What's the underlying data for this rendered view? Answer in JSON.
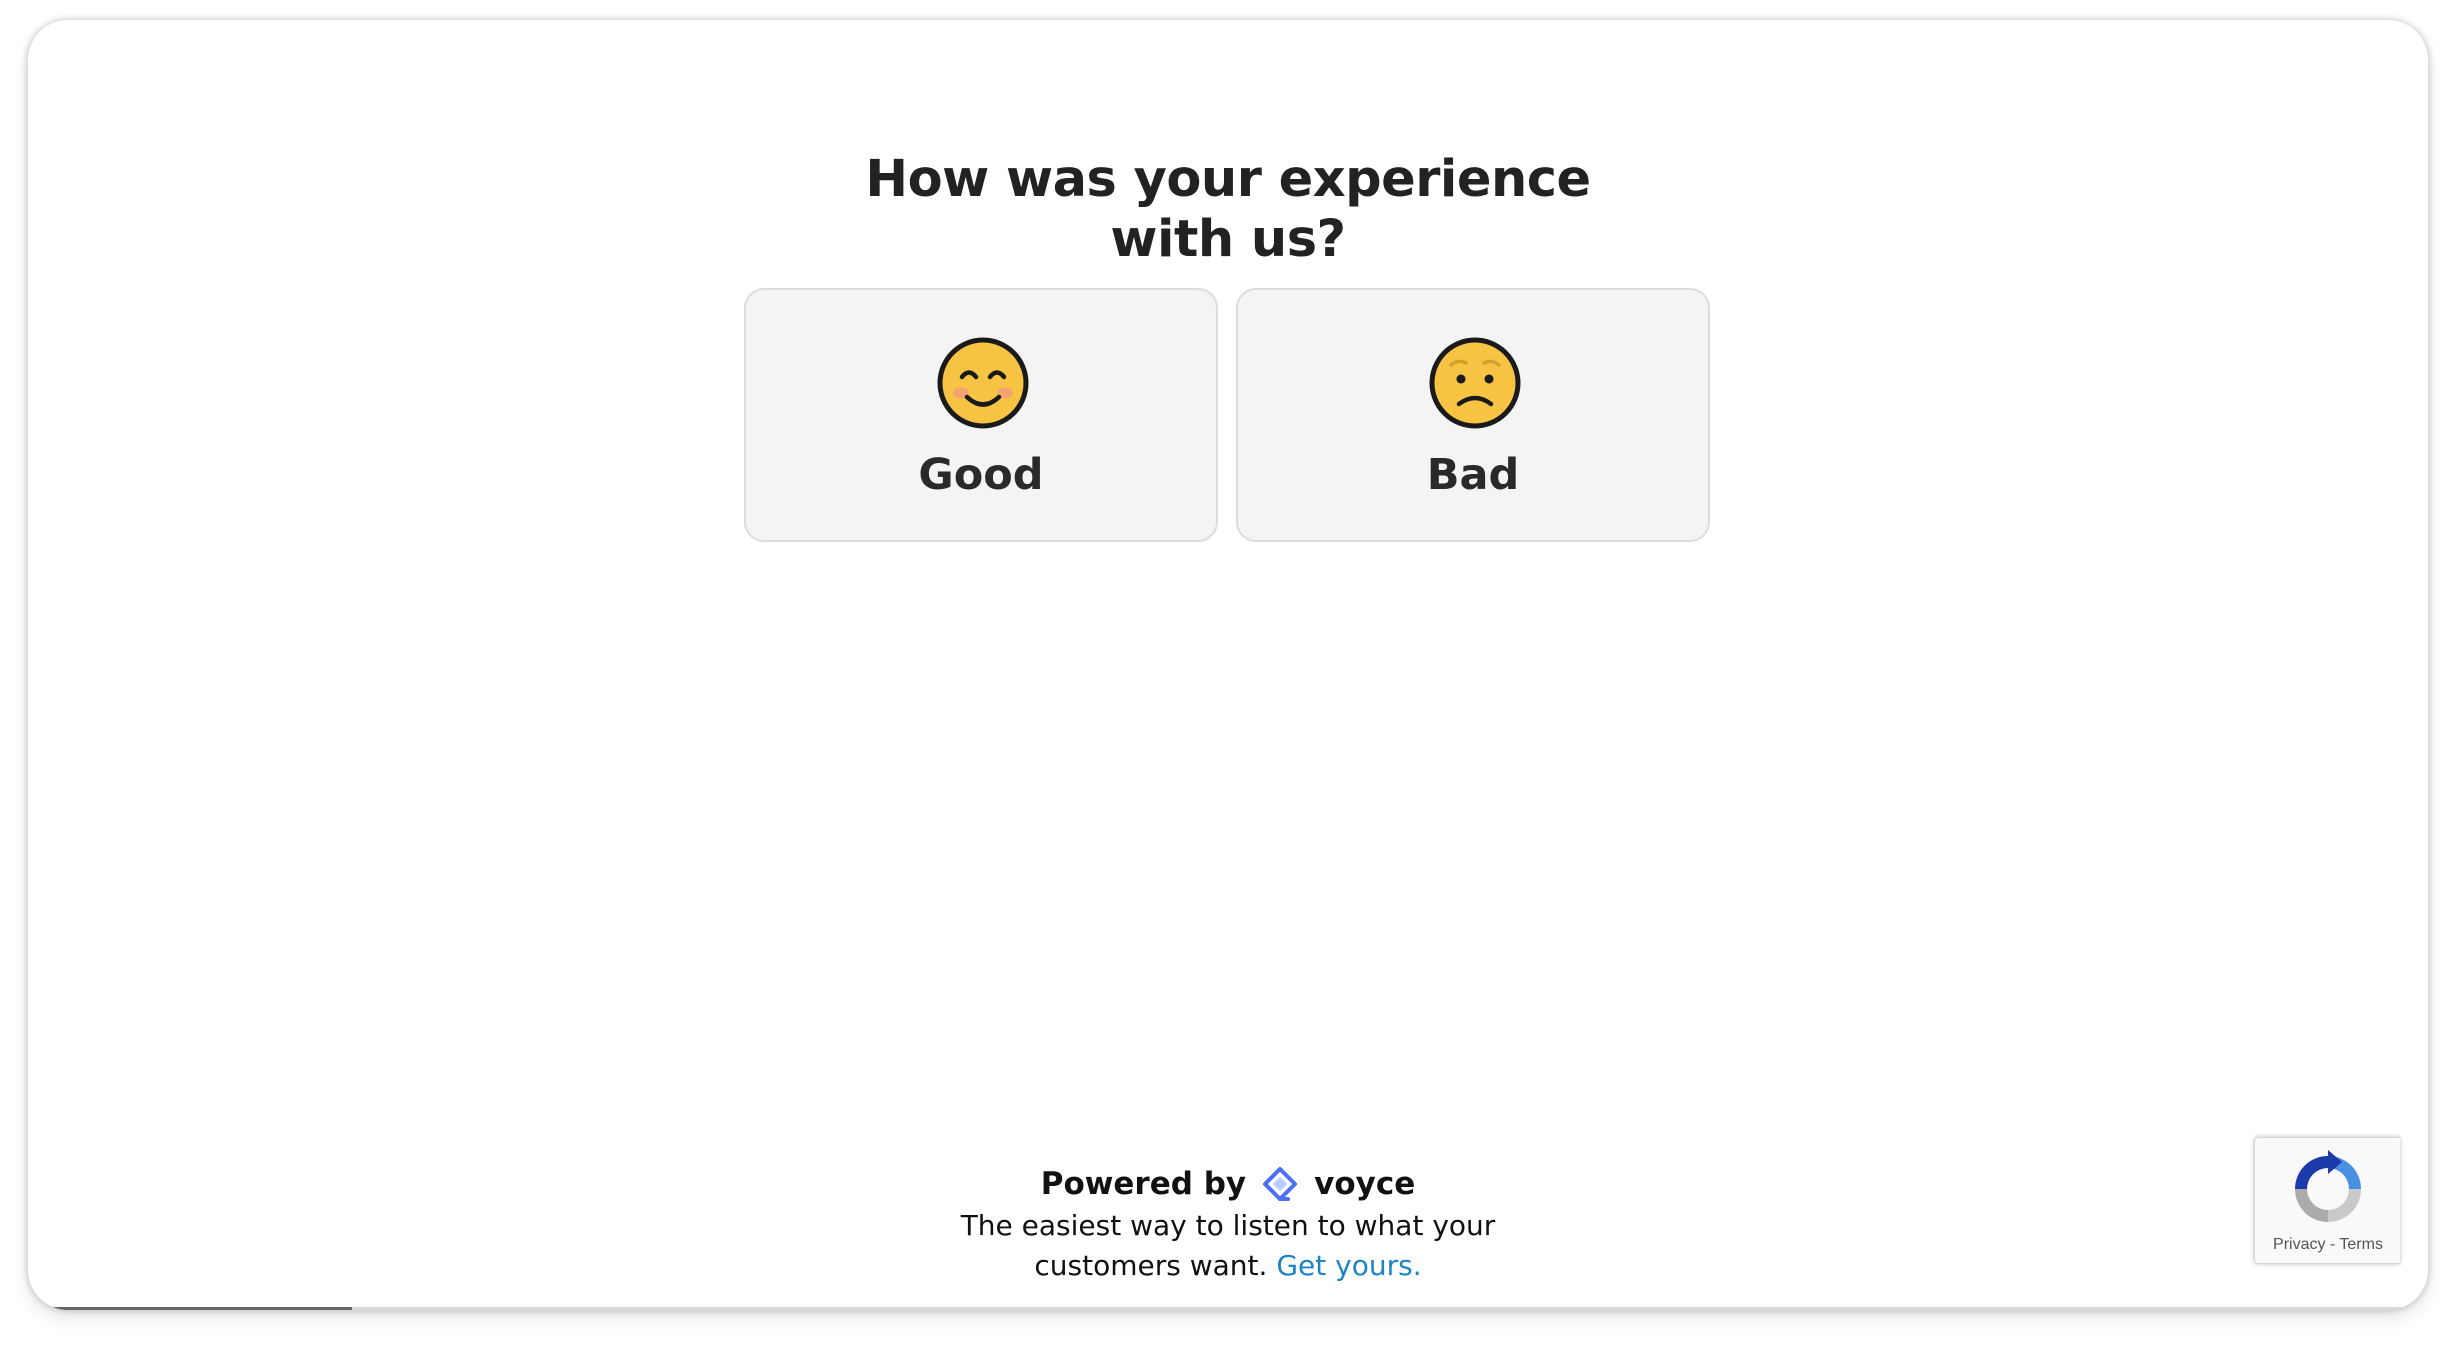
{
  "survey": {
    "question_line1": "How was your experience",
    "question_line2": "with us?",
    "options": [
      {
        "label": "Good",
        "icon": "smiling-face-icon"
      },
      {
        "label": "Bad",
        "icon": "worried-face-icon"
      }
    ]
  },
  "footer": {
    "powered_by": "Powered by",
    "brand": "voyce",
    "tagline_line1": "The easiest way to listen to what your",
    "tagline_line2": "customers want.",
    "cta_link": "Get yours."
  },
  "recaptcha": {
    "privacy": "Privacy",
    "separator": "-",
    "terms": "Terms"
  },
  "progress": {
    "fraction": 0.135
  },
  "colors": {
    "link": "#1f84c4",
    "emoji_face": "#f6c343",
    "brand_logo": "#4c6ef5"
  }
}
